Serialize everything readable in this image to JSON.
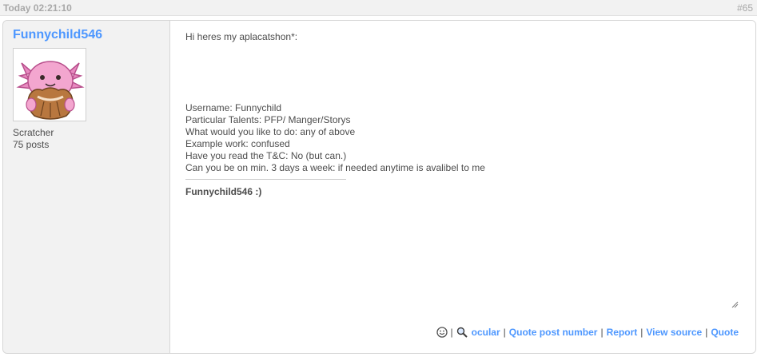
{
  "header": {
    "timestamp": "Today 02:21:10",
    "post_number": "#65"
  },
  "author": {
    "username": "Funnychild546",
    "role": "Scratcher",
    "post_count": "75 posts",
    "avatar_icon": "pink-axolotl-avatar-icon"
  },
  "message": {
    "greeting": "Hi heres my aplacatshon*:",
    "lines": [
      "Username: Funnychild",
      "Particular Talents: PFP/ Manger/Storys",
      "What would you like to do: any of above",
      "Example work: confused",
      "Have you read the T&C: No (but can.)",
      "Can you be on min. 3 days a week: if needed anytime is avalibel to me"
    ],
    "signature": "Funnychild546 :)"
  },
  "actions": {
    "separator": "|",
    "ocular_label": "ocular",
    "quote_post_number_label": "Quote post number",
    "report_label": "Report",
    "view_source_label": "View source",
    "quote_label": "Quote"
  },
  "colors": {
    "link": "#4d97ff",
    "text": "#4d4d4d",
    "muted": "#a8a8a8",
    "panel": "#f2f2f2",
    "border": "#d6d6d6"
  }
}
